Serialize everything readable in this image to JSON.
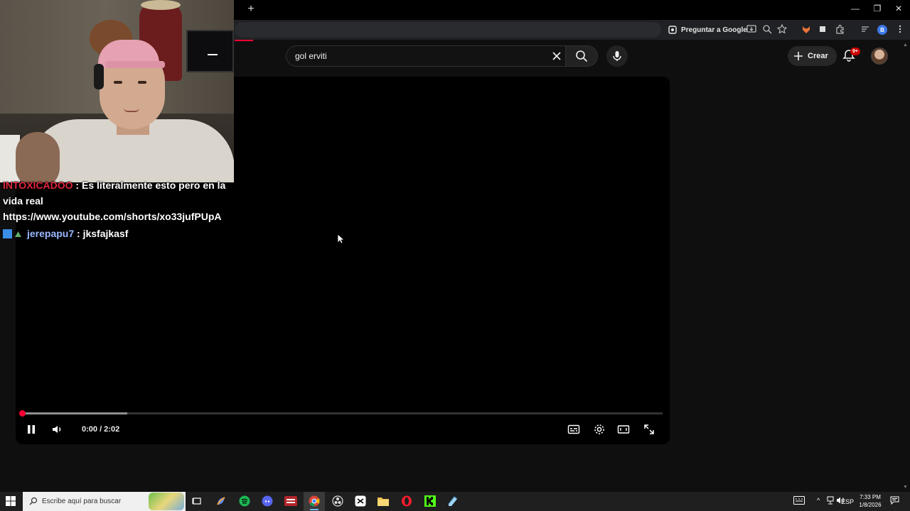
{
  "browser": {
    "ask_google_label": "Preguntar a Google",
    "profile_letter": "B"
  },
  "youtube": {
    "search": {
      "value": "gol erviti"
    },
    "create_label": "Crear",
    "notifications_badge": "9+"
  },
  "player": {
    "time_display": "0:00 / 2:02",
    "buffered_fraction": 0.163,
    "played_fraction": 0.0
  },
  "chat": {
    "messages": [
      {
        "user": "INTOXICADOO",
        "separator": " : ",
        "text": "Es literalmente esto pero en la vida real https://www.youtube.com/shorts/xo33jufPUpA"
      },
      {
        "user": "jerepapu7",
        "separator": " : ",
        "text": "jksfajkasf"
      }
    ]
  },
  "taskbar": {
    "search_placeholder": "Escribe aquí para buscar",
    "language": "ESP",
    "time": "7:33 PM",
    "date": "1/8/2026"
  },
  "colors": {
    "accent_red": "#ff0033",
    "chat_red": "#e0253b",
    "chat_blue": "#9bb7ff"
  }
}
